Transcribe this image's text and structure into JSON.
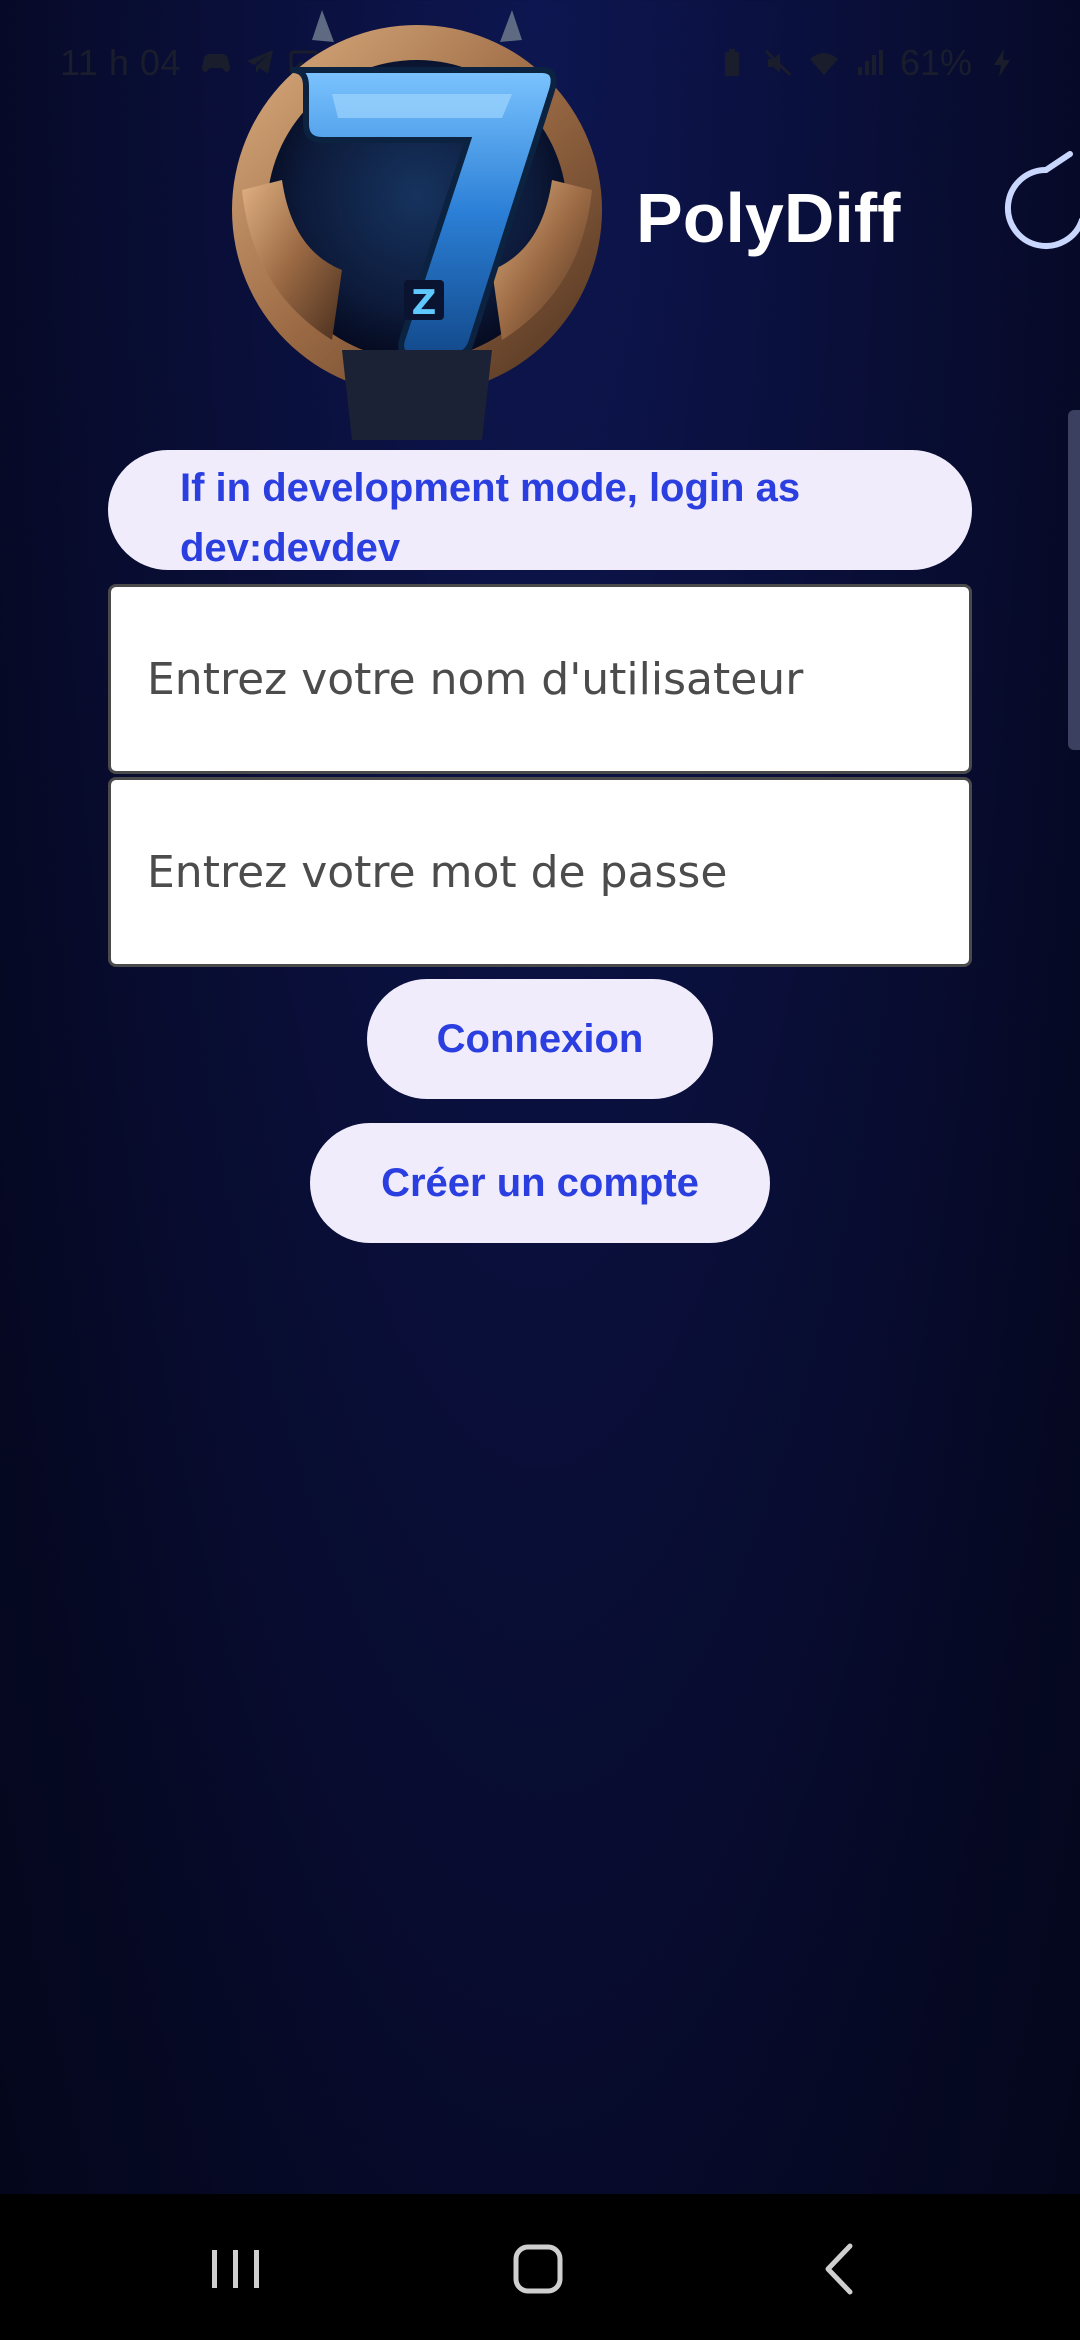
{
  "status_bar": {
    "time": "11 h 04",
    "battery": "61%",
    "left_icons": [
      "gamepad-icon",
      "telegram-icon",
      "image-icon",
      "dot-icon"
    ],
    "right_icons": [
      "battery-saver-icon",
      "mute-icon",
      "wifi-icon",
      "signal-icon",
      "charging-icon"
    ]
  },
  "header": {
    "title": "PolyDiff",
    "logo_icon": "seven-emblem-logo",
    "spinner_icon": "loading-spinner-icon"
  },
  "login": {
    "dev_notice": "If in development mode, login as dev:devdev",
    "username_placeholder": "Entrez votre nom d'utilisateur",
    "password_placeholder": "Entrez votre mot de passe",
    "login_label": "Connexion",
    "signup_label": "Créer un compte"
  },
  "nav": {
    "recents_icon": "recents-icon",
    "home_icon": "home-icon",
    "back_icon": "back-icon"
  },
  "colors": {
    "background": "#0a0f3a",
    "pill_bg": "#f0ecfb",
    "accent_text": "#2b3fe0",
    "title_text": "#ffffff"
  }
}
